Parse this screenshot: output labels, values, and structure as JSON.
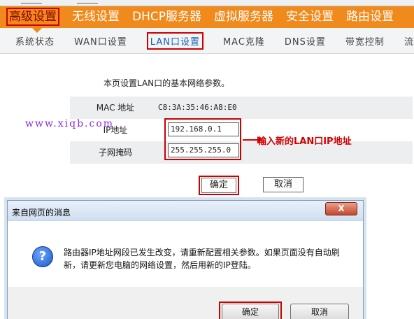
{
  "main_nav": {
    "items": [
      {
        "label": "高级设置",
        "active": true
      },
      {
        "label": "无线设置",
        "active": false
      },
      {
        "label": "DHCP服务器",
        "active": false
      },
      {
        "label": "虚拟服务器",
        "active": false
      },
      {
        "label": "安全设置",
        "active": false
      },
      {
        "label": "路由设置",
        "active": false
      }
    ],
    "color": "#f08a1c"
  },
  "sub_nav": {
    "items": [
      {
        "label": "系统状态"
      },
      {
        "label": "WAN口设置"
      },
      {
        "label": "LAN口设置",
        "active": true
      },
      {
        "label": "MAC克隆"
      },
      {
        "label": "DNS设置"
      },
      {
        "label": "带宽控制"
      },
      {
        "label": "流"
      }
    ]
  },
  "content": {
    "description": "本页设置LAN口的基本网络参数。",
    "mac_label": "MAC 地址",
    "mac_value": "C8:3A:35:46:A8:E0",
    "ip_label": "IP地址",
    "ip_value": "192.168.0.1",
    "mask_label": "子网掩码",
    "mask_value": "255.255.255.0",
    "annotation": "输入新的LAN口IP地址",
    "watermark": "www.xiqb.com",
    "ok_label": "确定",
    "cancel_label": "取消"
  },
  "dialog": {
    "title": "来自网页的消息",
    "close_label": "X",
    "icon": "question-icon",
    "message": "路由器IP地址网段已发生改变，请重新配置相关参数。如果页面没有自动刷新，请更新您电脑的网络设置，然后用新的IP登陆。",
    "ok_label": "确定",
    "cancel_label": "取消"
  }
}
